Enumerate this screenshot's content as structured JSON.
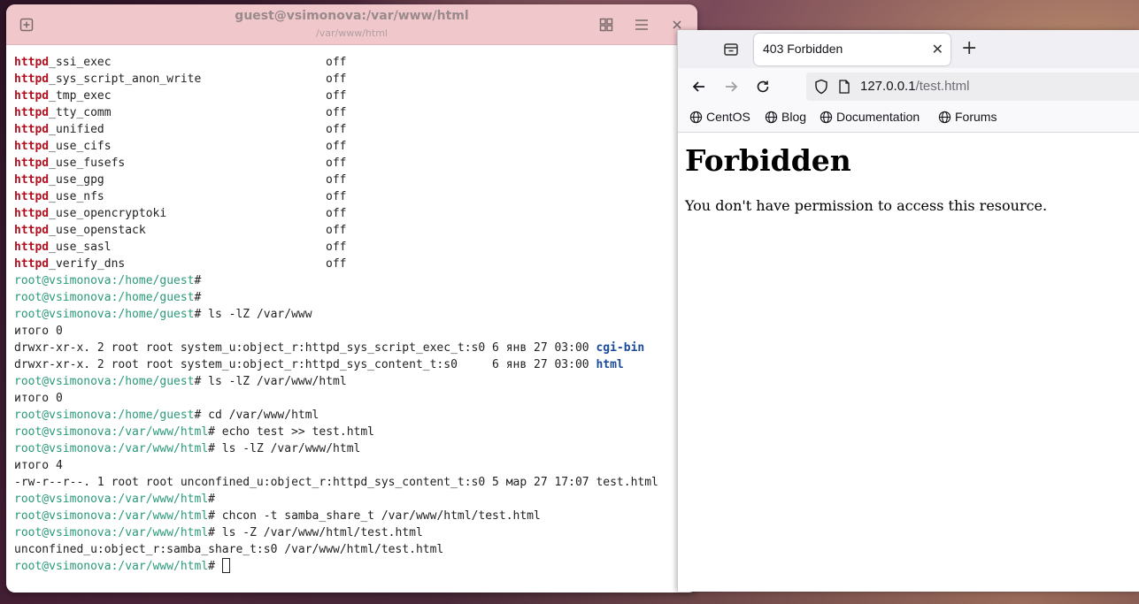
{
  "terminal": {
    "title": "guest@vsimonova:/var/www/html",
    "subtitle": "/var/www/html",
    "booleans": [
      {
        "name": "_ssi_exec",
        "value": "off"
      },
      {
        "name": "_sys_script_anon_write",
        "value": "off"
      },
      {
        "name": "_tmp_exec",
        "value": "off"
      },
      {
        "name": "_tty_comm",
        "value": "off"
      },
      {
        "name": "_unified",
        "value": "off"
      },
      {
        "name": "_use_cifs",
        "value": "off"
      },
      {
        "name": "_use_fusefs",
        "value": "off"
      },
      {
        "name": "_use_gpg",
        "value": "off"
      },
      {
        "name": "_use_nfs",
        "value": "off"
      },
      {
        "name": "_use_opencryptoki",
        "value": "off"
      },
      {
        "name": "_use_openstack",
        "value": "off"
      },
      {
        "name": "_use_sasl",
        "value": "off"
      },
      {
        "name": "_verify_dns",
        "value": "off"
      }
    ],
    "keyword": "httpd",
    "prompt_user": "root@vsimonova",
    "path_home": ":/home/guest",
    "path_html": ":/var/www/html",
    "prompt_hash": "#",
    "cmd_ls_www": " ls -lZ /var/www",
    "total0": "итого 0",
    "cgibin_line": "drwxr-xr-x. 2 root root system_u:object_r:httpd_sys_script_exec_t:s0 6 янв 27 03:00 ",
    "cgibin_name": "cgi-bin",
    "html_line": "drwxr-xr-x. 2 root root system_u:object_r:httpd_sys_content_t:s0     6 янв 27 03:00 ",
    "html_name": "html",
    "cmd_ls_html": " ls -lZ /var/www/html",
    "total0b": "итого 0",
    "cmd_cd": " cd /var/www/html",
    "cmd_echo": " echo test >> test.html",
    "cmd_ls_html2": " ls -lZ /var/www/html",
    "total4": "итого 4",
    "file_line": "-rw-r--r--. 1 root root unconfined_u:object_r:httpd_sys_content_t:s0 5 мар 27 17:07 test.html",
    "cmd_chcon": " chcon -t samba_share_t /var/www/html/test.html",
    "cmd_lsz": " ls -Z /var/www/html/test.html",
    "lsz_out": "unconfined_u:object_r:samba_share_t:s0 /var/www/html/test.html"
  },
  "browser": {
    "tab_title": "403 Forbidden",
    "url_host": "127.0.0.1",
    "url_path": "/test.html",
    "bookmarks": [
      "CentOS",
      "Blog",
      "Documentation",
      "Forums"
    ],
    "page_heading": "Forbidden",
    "page_text": "You don't have permission to access this resource."
  }
}
